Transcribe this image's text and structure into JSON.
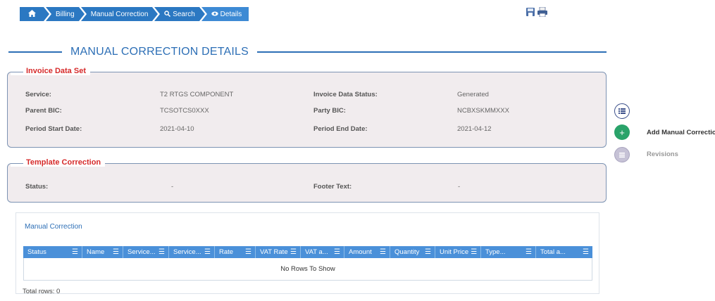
{
  "breadcrumb": {
    "home_icon": "home-icon",
    "items": [
      "Billing",
      "Manual Correction",
      "Search",
      "Details"
    ],
    "search_icon": "search-icon",
    "details_icon": "eye-icon"
  },
  "toolbar": {
    "icons": [
      "save-icon",
      "print-icon"
    ]
  },
  "page_title": "MANUAL CORRECTION DETAILS",
  "invoice_data_set": {
    "legend": "Invoice Data Set",
    "service_label": "Service:",
    "service_value": "T2 RTGS COMPONENT",
    "status_label": "Invoice Data Status:",
    "status_value": "Generated",
    "parent_bic_label": "Parent BIC:",
    "parent_bic_value": "TCSOTCS0XXX",
    "party_bic_label": "Party BIC:",
    "party_bic_value": "NCBXSKMMXXX",
    "start_label": "Period Start Date:",
    "start_value": "2021-04-10",
    "end_label": "Period End Date:",
    "end_value": "2021-04-12"
  },
  "template_correction": {
    "legend": "Template Correction",
    "status_label": "Status:",
    "status_value": "-",
    "footer_label": "Footer Text:",
    "footer_value": "-"
  },
  "side_actions": {
    "menu_icon": "list-icon",
    "add_label": "Add Manual Correction",
    "revisions_label": "Revisions",
    "colors": {
      "add": "#2aa36a",
      "disabled": "#c6c2d6",
      "menu_border": "#3b4f8a"
    }
  },
  "grid": {
    "title": "Manual Correction",
    "columns": [
      "Status",
      "Name",
      "Service...",
      "Service...",
      "Rate",
      "VAT Rate",
      "VAT a...",
      "Amount",
      "Quantity",
      "Unit Price",
      "Type...",
      "Total a..."
    ],
    "empty_text": "No Rows To Show",
    "total_rows": "Total rows: 0",
    "header_color": "#4a90d9"
  }
}
